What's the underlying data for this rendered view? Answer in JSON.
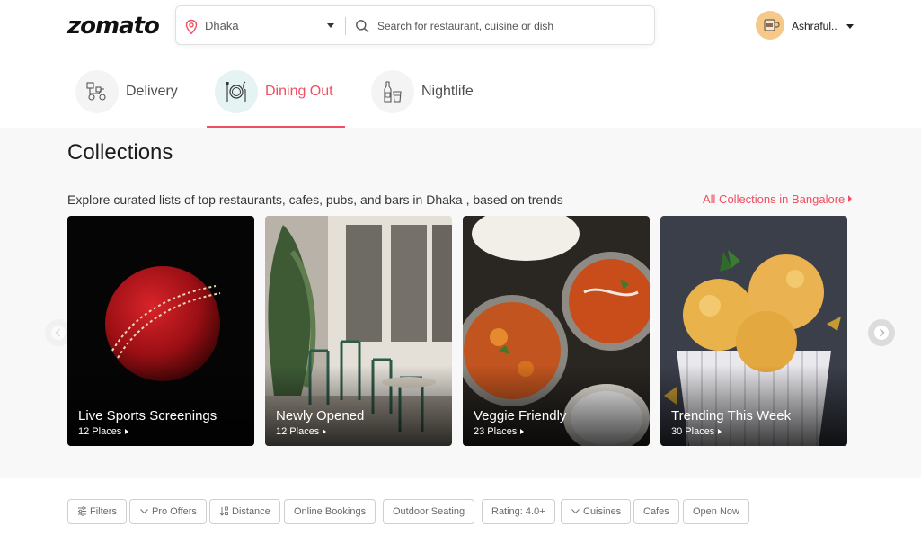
{
  "header": {
    "logo": "zomato",
    "location": "Dhaka",
    "search_placeholder": "Search for restaurant, cuisine or dish",
    "username": "Ashraful.."
  },
  "tabs": [
    {
      "label": "Delivery",
      "icon": "delivery-icon",
      "active": false
    },
    {
      "label": "Dining Out",
      "icon": "dining-out-icon",
      "active": true
    },
    {
      "label": "Nightlife",
      "icon": "nightlife-icon",
      "active": false
    }
  ],
  "collections": {
    "title": "Collections",
    "subtitle": "Explore curated lists of top restaurants, cafes, pubs, and bars in Dhaka , based on trends",
    "all_link": "All Collections in Bangalore",
    "cards": [
      {
        "title": "Live Sports Screenings",
        "places": "12 Places"
      },
      {
        "title": "Newly Opened",
        "places": "12 Places"
      },
      {
        "title": "Veggie Friendly",
        "places": "23 Places"
      },
      {
        "title": "Trending This Week",
        "places": "30 Places"
      }
    ]
  },
  "filters": [
    {
      "label": "Filters",
      "icon": "filter-icon"
    },
    {
      "label": "Pro Offers",
      "icon": "chevron-down-icon"
    },
    {
      "label": "Distance",
      "icon": "sort-icon"
    },
    {
      "label": "Online Bookings",
      "icon": ""
    },
    {
      "label": "Outdoor Seating",
      "icon": ""
    },
    {
      "label": "Rating: 4.0+",
      "icon": ""
    },
    {
      "label": "Cuisines",
      "icon": "chevron-down-icon"
    },
    {
      "label": "Cafes",
      "icon": ""
    },
    {
      "label": "Open Now",
      "icon": ""
    }
  ],
  "colors": {
    "brand": "#ef4f5f",
    "active_tab_bg": "#e5f3f3",
    "section_bg": "#f8f8f8"
  }
}
